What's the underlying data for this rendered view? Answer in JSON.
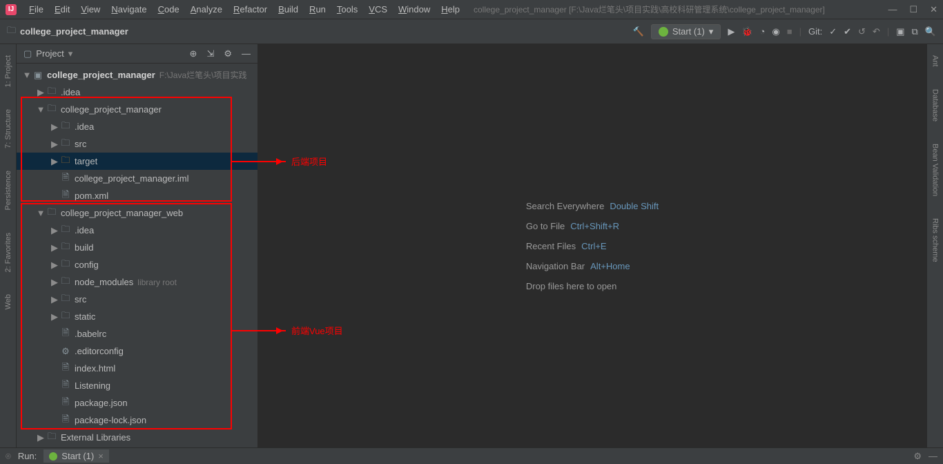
{
  "title_path": "college_project_manager [F:\\Java烂笔头\\项目实践\\高校科研管理系统\\college_project_manager]",
  "menus": [
    "File",
    "Edit",
    "View",
    "Navigate",
    "Code",
    "Analyze",
    "Refactor",
    "Build",
    "Run",
    "Tools",
    "VCS",
    "Window",
    "Help"
  ],
  "breadcrumb": "college_project_manager",
  "run_config": "Start (1)",
  "git_label": "Git:",
  "panel_title": "Project",
  "left_gutter": [
    "1: Project",
    "7: Structure",
    "Persistence",
    "2: Favorites",
    "Web"
  ],
  "right_gutter": [
    "Ant",
    "Database",
    "Bean Validation",
    "Ribs scheme"
  ],
  "tree": [
    {
      "d": 0,
      "a": "▼",
      "i": "module",
      "t": "college_project_manager",
      "bold": true,
      "h": "F:\\Java烂笔头\\项目实践"
    },
    {
      "d": 1,
      "a": "▶",
      "i": "folder",
      "t": ".idea"
    },
    {
      "d": 1,
      "a": "▼",
      "i": "folder",
      "t": "college_project_manager"
    },
    {
      "d": 2,
      "a": "▶",
      "i": "folder",
      "t": ".idea"
    },
    {
      "d": 2,
      "a": "▶",
      "i": "folder",
      "t": "src"
    },
    {
      "d": 2,
      "a": "▶",
      "i": "folder-o",
      "t": "target",
      "sel": true
    },
    {
      "d": 2,
      "a": "",
      "i": "file",
      "t": "college_project_manager.iml"
    },
    {
      "d": 2,
      "a": "",
      "i": "xml",
      "t": "pom.xml"
    },
    {
      "d": 1,
      "a": "▼",
      "i": "folder",
      "t": "college_project_manager_web"
    },
    {
      "d": 2,
      "a": "▶",
      "i": "folder",
      "t": ".idea"
    },
    {
      "d": 2,
      "a": "▶",
      "i": "folder",
      "t": "build"
    },
    {
      "d": 2,
      "a": "▶",
      "i": "folder",
      "t": "config"
    },
    {
      "d": 2,
      "a": "▶",
      "i": "lib",
      "t": "node_modules",
      "h": "library root"
    },
    {
      "d": 2,
      "a": "▶",
      "i": "folder",
      "t": "src"
    },
    {
      "d": 2,
      "a": "▶",
      "i": "folder",
      "t": "static"
    },
    {
      "d": 2,
      "a": "",
      "i": "file",
      "t": ".babelrc"
    },
    {
      "d": 2,
      "a": "",
      "i": "gear",
      "t": ".editorconfig"
    },
    {
      "d": 2,
      "a": "",
      "i": "html",
      "t": "index.html"
    },
    {
      "d": 2,
      "a": "",
      "i": "file",
      "t": "Listening"
    },
    {
      "d": 2,
      "a": "",
      "i": "json",
      "t": "package.json"
    },
    {
      "d": 2,
      "a": "",
      "i": "json",
      "t": "package-lock.json"
    },
    {
      "d": 1,
      "a": "▶",
      "i": "lib",
      "t": "External Libraries"
    }
  ],
  "welcome": [
    {
      "l": "Search Everywhere",
      "s": "Double Shift"
    },
    {
      "l": "Go to File",
      "s": "Ctrl+Shift+R"
    },
    {
      "l": "Recent Files",
      "s": "Ctrl+E"
    },
    {
      "l": "Navigation Bar",
      "s": "Alt+Home"
    },
    {
      "l": "Drop files here to open",
      "s": ""
    }
  ],
  "annotations": {
    "backend": "后端项目",
    "frontend": "前端Vue项目"
  },
  "bottom": {
    "run": "Run:",
    "tab": "Start (1)"
  }
}
